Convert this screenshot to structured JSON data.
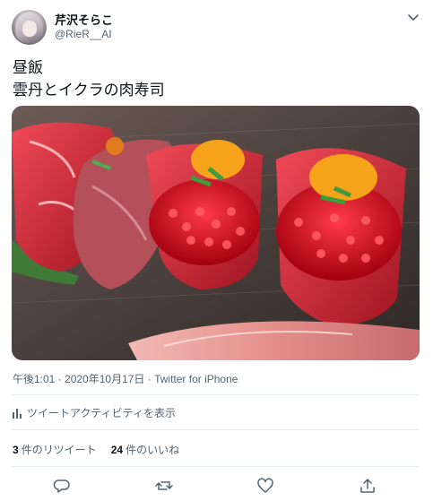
{
  "user": {
    "display_name": "芹沢そらこ",
    "handle": "@RieR__AI"
  },
  "tweet": {
    "lines": [
      "昼飯",
      "雲丹とイクラの肉寿司"
    ],
    "photo_alt": "",
    "timestamp": "午後1:01 · 2020年10月17日 · Twitter for iPhone"
  },
  "activity": {
    "label": "ツイートアクティビティを表示"
  },
  "stats": {
    "retweets_count": "3",
    "retweets_label": "件のリツイート",
    "likes_count": "24",
    "likes_label": "件のいいね"
  },
  "icons": {
    "more": "chevron-down-icon",
    "activity": "bar-chart-icon",
    "reply": "reply-icon",
    "retweet": "retweet-icon",
    "like": "heart-icon",
    "share": "share-icon"
  },
  "colors": {
    "text": "#0f1419",
    "secondary": "#536471",
    "divider": "#e6ecf0"
  }
}
